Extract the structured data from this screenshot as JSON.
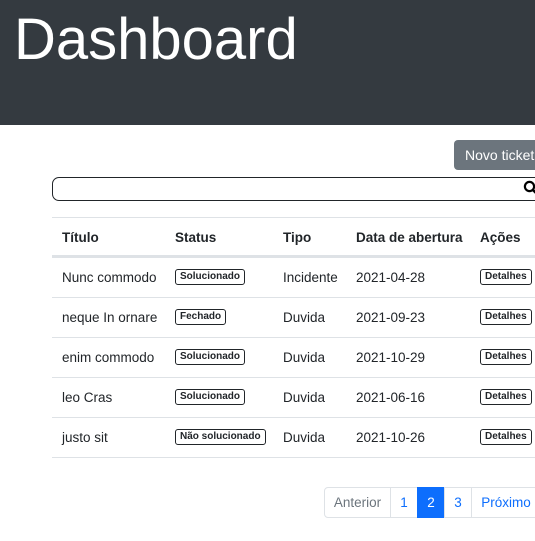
{
  "header": {
    "title": "Dashboard"
  },
  "toolbar": {
    "new_ticket_label": "Novo ticket"
  },
  "search": {
    "value": "",
    "placeholder": "",
    "icon": "search-icon"
  },
  "table": {
    "columns": [
      "Título",
      "Status",
      "Tipo",
      "Data de abertura",
      "Ações"
    ],
    "rows": [
      {
        "title": "Nunc commodo",
        "status": "Solucionado",
        "type": "Incidente",
        "date": "2021-04-28",
        "action": "Detalhes"
      },
      {
        "title": "neque In ornare",
        "status": "Fechado",
        "type": "Duvida",
        "date": "2021-09-23",
        "action": "Detalhes"
      },
      {
        "title": "enim commodo",
        "status": "Solucionado",
        "type": "Duvida",
        "date": "2021-10-29",
        "action": "Detalhes"
      },
      {
        "title": "leo Cras",
        "status": "Solucionado",
        "type": "Duvida",
        "date": "2021-06-16",
        "action": "Detalhes"
      },
      {
        "title": "justo sit",
        "status": "Não solucionado",
        "type": "Duvida",
        "date": "2021-10-26",
        "action": "Detalhes"
      }
    ]
  },
  "pagination": {
    "previous": "Anterior",
    "pages": [
      "1",
      "2",
      "3"
    ],
    "current": "2",
    "next": "Próximo"
  },
  "colors": {
    "header_bg": "#343a40",
    "button_secondary": "#6c757d",
    "primary": "#0d6efd",
    "border": "#dee2e6"
  }
}
